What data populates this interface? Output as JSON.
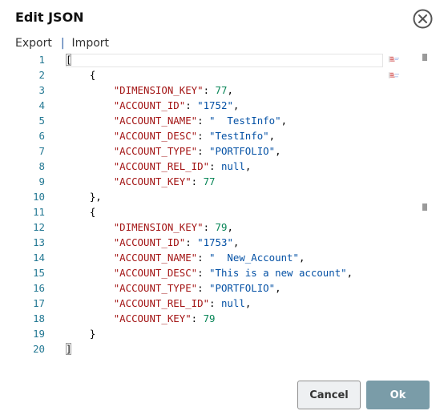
{
  "dialog": {
    "title": "Edit JSON"
  },
  "menu": {
    "export_label": "Export",
    "separator": "|",
    "import_label": "Import"
  },
  "editor": {
    "line_numbers": [
      "1",
      "2",
      "3",
      "4",
      "5",
      "6",
      "7",
      "8",
      "9",
      "10",
      "11",
      "12",
      "13",
      "14",
      "15",
      "16",
      "17",
      "18",
      "19",
      "20"
    ],
    "lines": [
      [
        {
          "t": "[",
          "c": "p"
        }
      ],
      [
        {
          "t": "    {",
          "c": "p"
        }
      ],
      [
        {
          "t": "        ",
          "c": "p"
        },
        {
          "t": "\"DIMENSION_KEY\"",
          "c": "k"
        },
        {
          "t": ": ",
          "c": "p"
        },
        {
          "t": "77",
          "c": "n"
        },
        {
          "t": ",",
          "c": "p"
        }
      ],
      [
        {
          "t": "        ",
          "c": "p"
        },
        {
          "t": "\"ACCOUNT_ID\"",
          "c": "k"
        },
        {
          "t": ": ",
          "c": "p"
        },
        {
          "t": "\"1752\"",
          "c": "s"
        },
        {
          "t": ",",
          "c": "p"
        }
      ],
      [
        {
          "t": "        ",
          "c": "p"
        },
        {
          "t": "\"ACCOUNT_NAME\"",
          "c": "k"
        },
        {
          "t": ": ",
          "c": "p"
        },
        {
          "t": "\"  TestInfo\"",
          "c": "s"
        },
        {
          "t": ",",
          "c": "p"
        }
      ],
      [
        {
          "t": "        ",
          "c": "p"
        },
        {
          "t": "\"ACCOUNT_DESC\"",
          "c": "k"
        },
        {
          "t": ": ",
          "c": "p"
        },
        {
          "t": "\"TestInfo\"",
          "c": "s"
        },
        {
          "t": ",",
          "c": "p"
        }
      ],
      [
        {
          "t": "        ",
          "c": "p"
        },
        {
          "t": "\"ACCOUNT_TYPE\"",
          "c": "k"
        },
        {
          "t": ": ",
          "c": "p"
        },
        {
          "t": "\"PORTFOLIO\"",
          "c": "s"
        },
        {
          "t": ",",
          "c": "p"
        }
      ],
      [
        {
          "t": "        ",
          "c": "p"
        },
        {
          "t": "\"ACCOUNT_REL_ID\"",
          "c": "k"
        },
        {
          "t": ": ",
          "c": "p"
        },
        {
          "t": "null",
          "c": "l"
        },
        {
          "t": ",",
          "c": "p"
        }
      ],
      [
        {
          "t": "        ",
          "c": "p"
        },
        {
          "t": "\"ACCOUNT_KEY\"",
          "c": "k"
        },
        {
          "t": ": ",
          "c": "p"
        },
        {
          "t": "77",
          "c": "n"
        }
      ],
      [
        {
          "t": "    },",
          "c": "p"
        }
      ],
      [
        {
          "t": "    {",
          "c": "p"
        }
      ],
      [
        {
          "t": "        ",
          "c": "p"
        },
        {
          "t": "\"DIMENSION_KEY\"",
          "c": "k"
        },
        {
          "t": ": ",
          "c": "p"
        },
        {
          "t": "79",
          "c": "n"
        },
        {
          "t": ",",
          "c": "p"
        }
      ],
      [
        {
          "t": "        ",
          "c": "p"
        },
        {
          "t": "\"ACCOUNT_ID\"",
          "c": "k"
        },
        {
          "t": ": ",
          "c": "p"
        },
        {
          "t": "\"1753\"",
          "c": "s"
        },
        {
          "t": ",",
          "c": "p"
        }
      ],
      [
        {
          "t": "        ",
          "c": "p"
        },
        {
          "t": "\"ACCOUNT_NAME\"",
          "c": "k"
        },
        {
          "t": ": ",
          "c": "p"
        },
        {
          "t": "\"  New_Account\"",
          "c": "s"
        },
        {
          "t": ",",
          "c": "p"
        }
      ],
      [
        {
          "t": "        ",
          "c": "p"
        },
        {
          "t": "\"ACCOUNT_DESC\"",
          "c": "k"
        },
        {
          "t": ": ",
          "c": "p"
        },
        {
          "t": "\"This is a new account\"",
          "c": "s"
        },
        {
          "t": ",",
          "c": "p"
        }
      ],
      [
        {
          "t": "        ",
          "c": "p"
        },
        {
          "t": "\"ACCOUNT_TYPE\"",
          "c": "k"
        },
        {
          "t": ": ",
          "c": "p"
        },
        {
          "t": "\"PORTFOLIO\"",
          "c": "s"
        },
        {
          "t": ",",
          "c": "p"
        }
      ],
      [
        {
          "t": "        ",
          "c": "p"
        },
        {
          "t": "\"ACCOUNT_REL_ID\"",
          "c": "k"
        },
        {
          "t": ": ",
          "c": "p"
        },
        {
          "t": "null",
          "c": "l"
        },
        {
          "t": ",",
          "c": "p"
        }
      ],
      [
        {
          "t": "        ",
          "c": "p"
        },
        {
          "t": "\"ACCOUNT_KEY\"",
          "c": "k"
        },
        {
          "t": ": ",
          "c": "p"
        },
        {
          "t": "79",
          "c": "n"
        }
      ],
      [
        {
          "t": "    }",
          "c": "p"
        }
      ],
      [
        {
          "t": "]",
          "c": "p"
        }
      ]
    ]
  },
  "buttons": {
    "cancel_label": "Cancel",
    "ok_label": "Ok"
  },
  "icons": {
    "close": "close-circle-icon"
  },
  "colors": {
    "key": "#a31515",
    "string": "#0451a5",
    "number": "#098658",
    "line_number": "#237893",
    "ok_button": "#7a9ca8",
    "cancel_button": "#eef0f2"
  }
}
